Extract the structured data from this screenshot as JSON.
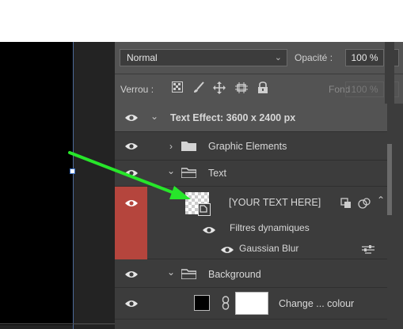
{
  "layers_panel": {
    "blend_mode": "Normal",
    "opacity_label": "Opacité :",
    "opacity_value": "100 %",
    "lock_label": "Verrou :",
    "fill_label": "Fond :",
    "fill_value": "100 %",
    "layers": [
      {
        "name": "Text Effect: 3600 x 2400 px",
        "type": "group-header",
        "expanded": true,
        "visible": true
      },
      {
        "name": "Graphic Elements",
        "type": "group",
        "expanded": false,
        "visible": true
      },
      {
        "name": "Text",
        "type": "group",
        "expanded": true,
        "visible": true
      },
      {
        "name": "[YOUR TEXT HERE]",
        "type": "smart-object",
        "visible": true,
        "selected_eye": true
      },
      {
        "name": "Filtres dynamiques",
        "type": "smart-filters",
        "visible": true
      },
      {
        "name": "Gaussian Blur",
        "type": "filter",
        "visible": true
      },
      {
        "name": "Background",
        "type": "group",
        "expanded": true,
        "visible": true
      },
      {
        "name": "Change ... colour",
        "type": "adjustment-with-mask",
        "visible": true
      }
    ]
  },
  "colors": {
    "panel_bg": "#535353",
    "eye_highlight": "#b5453d",
    "arrow": "#27e62a"
  },
  "icons": [
    "eye-icon",
    "chevron-down-icon",
    "chevron-right-icon",
    "folder-icon",
    "lock-icon",
    "move-icon",
    "brush-icon",
    "artboard-icon",
    "checker-icon",
    "link-icon",
    "filter-settings-icon"
  ]
}
